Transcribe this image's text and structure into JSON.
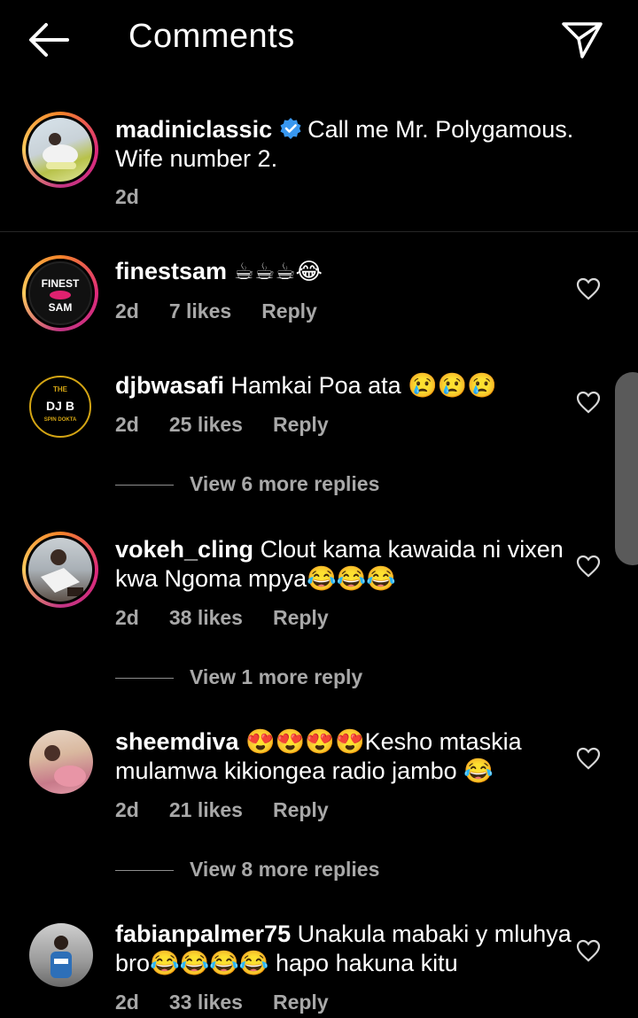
{
  "header": {
    "title": "Comments"
  },
  "caption": {
    "username": "madiniclassic",
    "text": "Call me Mr. Polygamous. Wife number 2.",
    "time": "2d"
  },
  "comments": [
    {
      "username": "finestsam",
      "text": "☕☕☕😂",
      "time": "2d",
      "likes": "7 likes",
      "reply": "Reply",
      "avatar_label_1": "FINEST",
      "avatar_label_2": "SAM"
    },
    {
      "username": "djbwasafi",
      "text": "Hamkai Poa ata 😢😢😢",
      "time": "2d",
      "likes": "25 likes",
      "reply": "Reply",
      "view_more": "View 6 more replies",
      "avatar_label_1": "THE",
      "avatar_label_2": "DJ B",
      "avatar_label_3": "SPIN DOKTA"
    },
    {
      "username": "vokeh_cling",
      "text": "Clout kama kawaida ni vixen kwa Ngoma mpya😂😂😂",
      "time": "2d",
      "likes": "38 likes",
      "reply": "Reply",
      "view_more": "View 1 more reply"
    },
    {
      "username": "sheemdiva",
      "text": "😍😍😍😍Kesho mtaskia mulamwa kikiongea radio jambo 😂",
      "time": "2d",
      "likes": "21 likes",
      "reply": "Reply",
      "view_more": "View 8 more replies"
    },
    {
      "username": "fabianpalmer75",
      "text": "Unakula mabaki y mluhya bro😂😂😂😂 hapo hakuna kitu",
      "time": "2d",
      "likes": "33 likes",
      "reply": "Reply"
    }
  ],
  "colors": {
    "background": "#000000",
    "text": "#ffffff",
    "secondary": "#a8a8a8",
    "verified": "#3897f0"
  },
  "icons": {
    "back": "arrow-left-icon",
    "send": "paper-plane-icon",
    "like": "heart-outline-icon",
    "verified": "verified-badge-icon"
  }
}
